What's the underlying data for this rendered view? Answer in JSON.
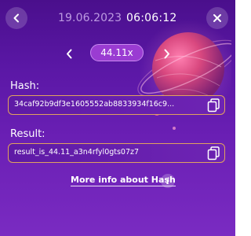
{
  "header": {
    "date": "19.06.2023",
    "time": "06:06:12",
    "back_icon": "chevron-left-icon",
    "close_icon": "close-icon"
  },
  "round_nav": {
    "multiplier": "44.11x",
    "prev_icon": "chevron-left-icon",
    "next_icon": "chevron-right-icon"
  },
  "hash": {
    "label": "Hash:",
    "value": "34caf92b9df3e1605552ab8833934f16c9...",
    "copy_icon": "copy-icon"
  },
  "result": {
    "label": "Result:",
    "value": "result_is_44.11_a3n4rfyl0gts07z7",
    "copy_icon": "copy-icon"
  },
  "footer": {
    "more_info_label": "More info about Hash",
    "info_icon": "info-icon"
  },
  "colors": {
    "background_top": "#4a0f8c",
    "background_bottom": "#7a2bc2",
    "field_border": "#e0a25e",
    "multiplier_pill": "#9a3cd2",
    "date_text": "#e6cdff"
  }
}
